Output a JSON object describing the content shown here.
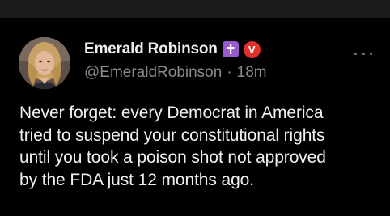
{
  "tweet": {
    "author": {
      "display_name": "Emerald Robinson",
      "handle": "@EmeraldRobinson",
      "badges": [
        "cross-badge-icon",
        "verified-v-badge-icon"
      ]
    },
    "separator": "·",
    "timestamp": "18m",
    "more_icon": "more-horizontal-icon",
    "text_lines": [
      "Never forget: every Democrat in America",
      "tried to suspend your constitutional rights",
      "until you took a poison shot not approved",
      "by the FDA just 12 months ago."
    ]
  },
  "colors": {
    "background": "#000000",
    "top_strip": "#1b1b1d",
    "text_primary": "#f0f0f0",
    "text_secondary": "#8b8b8f",
    "cross_badge": "#9b59d0",
    "v_badge": "#e0312a"
  }
}
